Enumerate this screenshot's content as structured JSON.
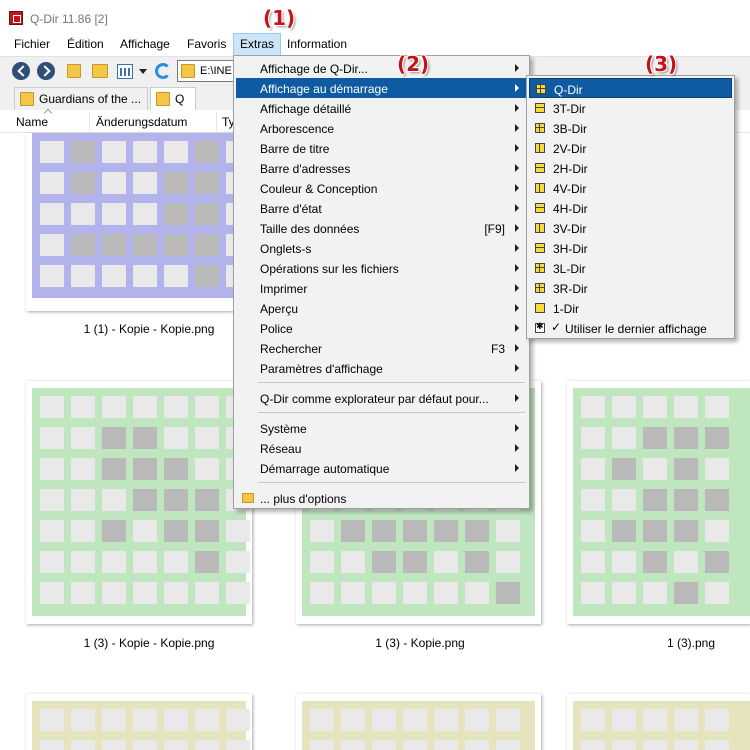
{
  "window": {
    "title": "Q-Dir 11.86 [2]"
  },
  "menubar": {
    "items": [
      "Fichier",
      "Édition",
      "Affichage",
      "Favoris",
      "Extras",
      "Information"
    ]
  },
  "address": {
    "text": "E:\\INE"
  },
  "tabs": [
    {
      "label": "Guardians of the ..."
    },
    {
      "label": "Q"
    }
  ],
  "columns": [
    "Name",
    "Änderungsdatum",
    "Ty"
  ],
  "files": [
    {
      "name": "1 (1) - Kopie - Kopie.png",
      "color": "#b3b3eb"
    },
    {
      "name": "1 (3) - Kopie - Kopie.png",
      "color": "#bfe6bf"
    },
    {
      "name": "1 (3) - Kopie.png",
      "color": "#bfe6bf"
    },
    {
      "name": "1 (3).png",
      "color": "#bfe6bf"
    },
    {
      "name": "",
      "color": "#e6e3bf"
    }
  ],
  "extras_menu": {
    "items": [
      {
        "label": "Affichage de Q-Dir...",
        "submenu": true
      },
      {
        "label": "Affichage au démarrage",
        "submenu": true,
        "highlighted": true
      },
      {
        "label": "Affichage détaillé",
        "submenu": true
      },
      {
        "label": "Arborescence",
        "submenu": true
      },
      {
        "label": "Barre de titre",
        "submenu": true
      },
      {
        "label": "Barre d'adresses",
        "submenu": true
      },
      {
        "label": "Couleur & Conception",
        "submenu": true
      },
      {
        "label": "Barre d'état",
        "submenu": true
      },
      {
        "label": "Taille des données",
        "shortcut": "[F9]",
        "submenu": true
      },
      {
        "label": "Onglets-s",
        "submenu": true
      },
      {
        "label": "Opérations sur les fichiers",
        "submenu": true
      },
      {
        "label": "Imprimer",
        "submenu": true
      },
      {
        "label": "Aperçu",
        "submenu": true
      },
      {
        "label": "Police",
        "submenu": true
      },
      {
        "label": "Rechercher",
        "shortcut": "F3",
        "submenu": true
      },
      {
        "label": "Paramètres d'affichage",
        "submenu": true
      },
      {
        "label": "Q-Dir comme explorateur par défaut pour...",
        "submenu": true
      },
      {
        "label": "Système",
        "submenu": true
      },
      {
        "label": "Réseau",
        "submenu": true
      },
      {
        "label": "Démarrage automatique",
        "submenu": true
      },
      {
        "label": "... plus d'options",
        "submenu": false
      }
    ]
  },
  "startup_submenu": {
    "items": [
      {
        "label": "Q-Dir",
        "icon": "quad-icon",
        "highlighted": true
      },
      {
        "label": "3T-Dir",
        "icon": "layout-icon"
      },
      {
        "label": "3B-Dir",
        "icon": "layout-icon"
      },
      {
        "label": "2V-Dir",
        "icon": "layout-icon"
      },
      {
        "label": "2H-Dir",
        "icon": "layout-icon"
      },
      {
        "label": "4V-Dir",
        "icon": "layout-icon"
      },
      {
        "label": "4H-Dir",
        "icon": "layout-icon"
      },
      {
        "label": "3V-Dir",
        "icon": "layout-icon"
      },
      {
        "label": "3H-Dir",
        "icon": "layout-icon"
      },
      {
        "label": "3L-Dir",
        "icon": "layout-icon"
      },
      {
        "label": "3R-Dir",
        "icon": "layout-icon"
      },
      {
        "label": "1-Dir",
        "icon": "layout-icon"
      },
      {
        "label": "Utiliser le dernier affichage",
        "icon": "star-icon",
        "checked": true
      }
    ]
  },
  "callouts": [
    "(1)",
    "(2)",
    "(3)"
  ]
}
